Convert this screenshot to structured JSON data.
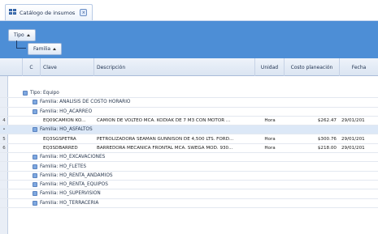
{
  "tab": {
    "title": "Catálogo de insumos",
    "icon": "table-icon"
  },
  "group_panel": {
    "buttons": [
      "Tipo",
      "Familia"
    ]
  },
  "columns": [
    "C",
    "Clave",
    "Descripción",
    "Unidad",
    "Costo planeación",
    "Fecha"
  ],
  "groups": {
    "tipo": "Tipo: Equipo",
    "familias": [
      "Familia: ANALISIS DE COSTO HORARIO",
      "Familia: HO_ACARREO",
      "Familia: HO_ASFALTOS",
      "Familia: HO_EXCAVACIONES",
      "Familia: HO_FLETES",
      "Familia: HO_RENTA_ANDAMIOS",
      "Familia: HO_RENTA_EQUIPOS",
      "Familia: HO_SUPERVISION",
      "Familia: HO_TERRACERIA"
    ]
  },
  "data_rows": [
    {
      "num": "4",
      "clave": "EQ09CAMION KO...",
      "desc": "CAMION DE VOLTEO MCA. KODIAK DE 7 M3 CON MOTOR ...",
      "unidad": "Hora",
      "costo": "$262.47",
      "fecha": "29/01/201"
    },
    {
      "num": "5",
      "clave": "EQ3SGSPETRA",
      "desc": "PETROLIZADORA SEAMAN GUNNISON DE 4,500 LTS. FORD...",
      "unidad": "Hora",
      "costo": "$300.76",
      "fecha": "29/01/201"
    },
    {
      "num": "6",
      "clave": "EQ3SDBARRED",
      "desc": "BARREDORA MECANICA FRONTAL MCA. SWEGA MOD. 930...",
      "unidad": "Hora",
      "costo": "$218.00",
      "fecha": "29/01/201"
    }
  ],
  "selected_marker": "•",
  "colors": {
    "group_panel": "#4d8ed6",
    "selection": "#dce8f7"
  }
}
